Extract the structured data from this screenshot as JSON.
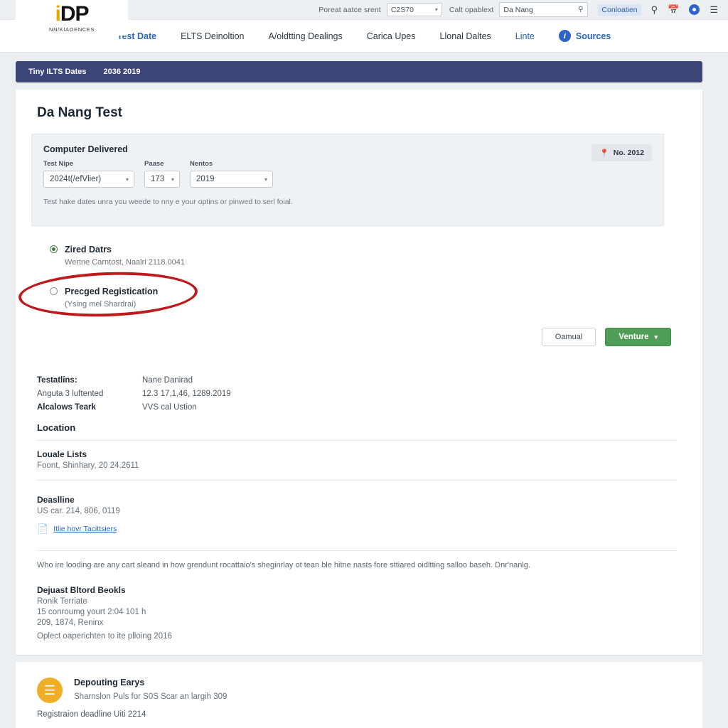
{
  "topbar": {
    "filter_label": "Poreat aatce srent",
    "filter_select_value": "C2S70",
    "location_label": "Calt opablext",
    "search_value": "Da Nang",
    "search_icon": "search-icon",
    "consultation_link": "Conloatien",
    "icons": [
      "search-icon",
      "calendar-icon",
      "account-icon",
      "menu-icon"
    ]
  },
  "logo": {
    "mark_i": "i",
    "mark_dp": "DP",
    "subtitle": "NN/KIAOENCES"
  },
  "nav": {
    "items": [
      {
        "label": "Test Date",
        "state": "active"
      },
      {
        "label": "ELTS Deinoltion",
        "state": "normal"
      },
      {
        "label": "A/oldtting Dealings",
        "state": "normal"
      },
      {
        "label": "Carica Upes",
        "state": "normal"
      },
      {
        "label": "Llonal Daltes",
        "state": "normal"
      },
      {
        "label": "Linte",
        "state": "link"
      }
    ],
    "info_badge": "i",
    "sources_label": "Sources"
  },
  "breadcrumb": {
    "items": [
      "Tiny ILTS Dates",
      "2036 2019"
    ]
  },
  "main": {
    "title": "Da Nang Test",
    "panel": {
      "title": "Computer Delivered",
      "fields": [
        {
          "label": "Test Nipe",
          "value": "2024t(/efVlier)"
        },
        {
          "label": "Paase",
          "value": "173"
        },
        {
          "label": "Nentos",
          "value": "2019"
        }
      ],
      "note": "Test hake dates unra you weede to nny e your optins or pinwed to serl foial.",
      "location_badge": {
        "icon": "location-pin-icon",
        "label": "No. 2012"
      }
    },
    "options": [
      {
        "label": "Zired Datrs",
        "sub": "Wertne Carntost, Naalri 2118.0041",
        "selected": true
      },
      {
        "label": "Precged Registication",
        "sub": "(Ysing mel Shardrai)",
        "selected": false
      }
    ],
    "buttons": {
      "cancel": "Oamual",
      "primary": "Venture",
      "primary_caret": "⌄"
    },
    "summary": [
      {
        "left": "Testatlins:",
        "left_bold": true,
        "right": "Nane Danirad"
      },
      {
        "left": "Anguta 3 luftented",
        "left_bold": false,
        "right": "12.3 17,1,46, 1289.2019"
      },
      {
        "left": "Alcalows Teark",
        "left_bold": true,
        "right": "VVS cal Ustion"
      }
    ],
    "sections": {
      "location": {
        "heading": "Location",
        "sub_head": "Louale Lists",
        "sub_text": "Foont, Shinhary, 20 24.2611"
      },
      "deadline": {
        "heading": "Deaslline",
        "value": "US car. 214, 806, 0119",
        "link_text": "Itlie hovr Tacittsiers",
        "link_icon": "pdf-icon"
      },
      "paragraph": "Who ire looding are any cart sleand in how grendunt rocattaio's sheginrlay ot tean ble hitne nasts fore sttiared oidltting salloo baseh. Dnr'nanlg.",
      "books": {
        "heading": "Dejuast Bltord Beokls",
        "lines": [
          "Ronik Terriate",
          "15 conroumg yourt 2:04 101 h",
          "209, 1874, Reninx",
          "Oplect oaperichten to ite plloing 2016"
        ]
      }
    }
  },
  "promo": {
    "icon": "document-icon",
    "title": "Depouting Earys",
    "subtitle": "Sharnslon Puls for S0S Scar an largih 309",
    "footer": "Registraion deadline Uiti 2214"
  },
  "colors": {
    "accent_blue": "#2a63c0",
    "breadcrumb_navy": "#3c4577",
    "primary_green": "#4f9d56",
    "annotation_red": "#c0191b",
    "promo_amber": "#f0ad28",
    "logo_gold": "#f0a500"
  }
}
